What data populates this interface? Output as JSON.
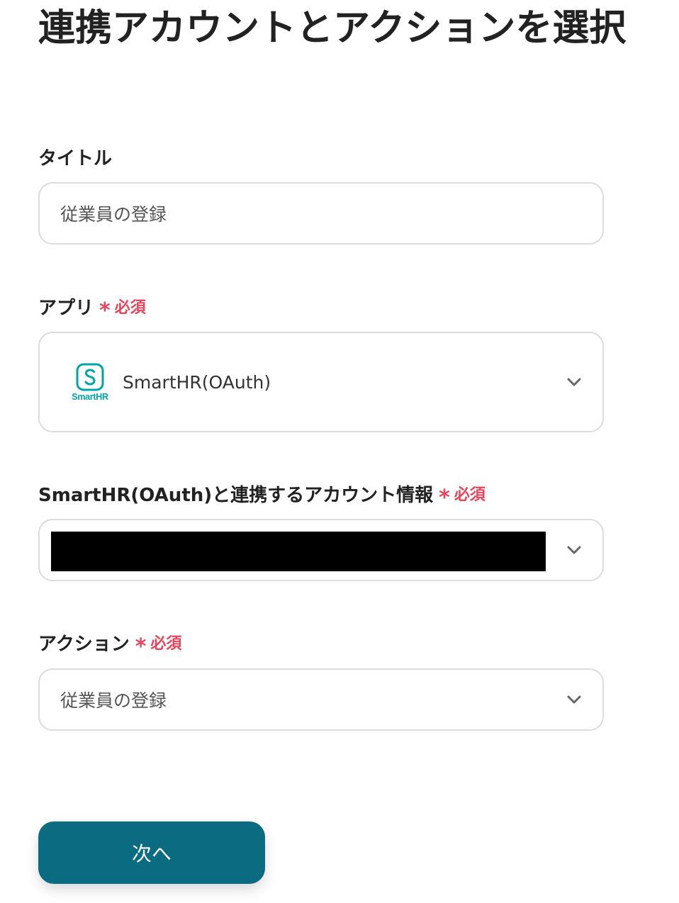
{
  "page": {
    "title": "連携アカウントとアクションを選択"
  },
  "required_marker": {
    "star": "*",
    "text": "必須",
    "color": "#e8455c"
  },
  "title_field": {
    "label": "タイトル",
    "value": "従業員の登録"
  },
  "app_field": {
    "label": "アプリ",
    "app_name": "SmartHR(OAuth)",
    "logo_text": "SmartHR",
    "logo_color": "#00a5a8",
    "icon": "chevron-down-icon"
  },
  "account_field": {
    "label": "SmartHR(OAuth)と連携するアカウント情報",
    "icon": "chevron-down-icon"
  },
  "action_field": {
    "label": "アクション",
    "value": "従業員の登録",
    "icon": "chevron-down-icon"
  },
  "footer": {
    "next_label": "次へ",
    "button_color": "#0b6b80"
  }
}
